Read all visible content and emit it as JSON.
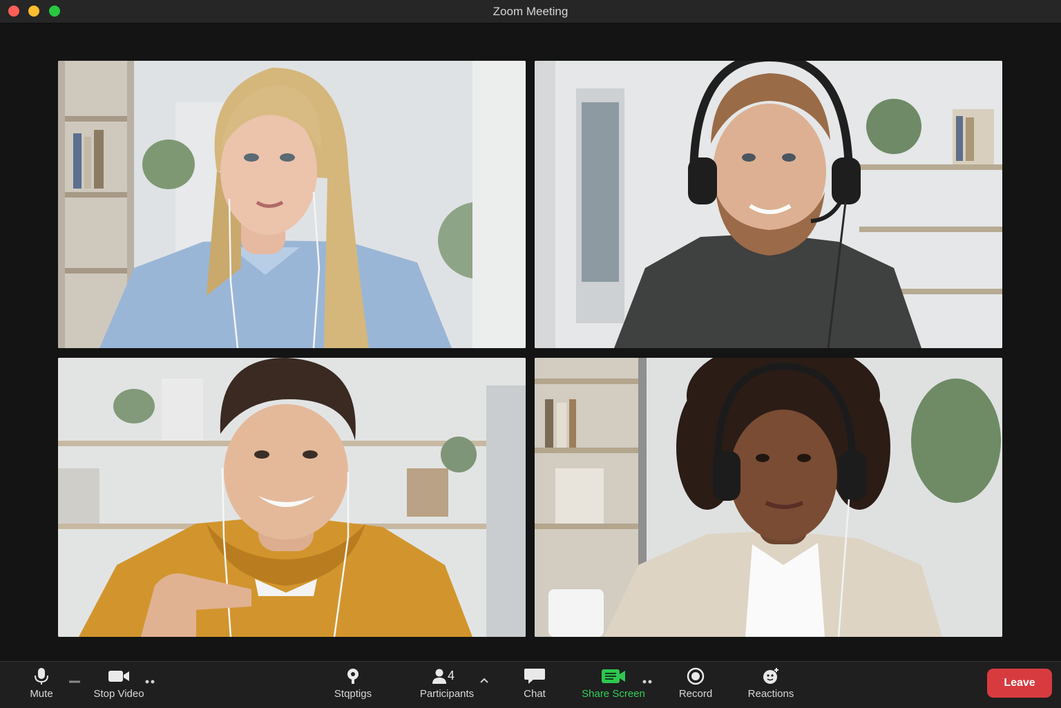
{
  "window": {
    "title": "Zoom Meeting"
  },
  "toolbar": {
    "mute": "Mute",
    "stop_video": "Stop Video",
    "settings": "Stqptigs",
    "participants": "Participants",
    "participant_count": "4",
    "chat": "Chat",
    "share_screen": "Share Screen",
    "record": "Record",
    "reactions": "Reactions",
    "leave": "Leave"
  },
  "colors": {
    "leave": "#d83b3f",
    "share_screen": "#35d05a",
    "window_bg": "#141414"
  },
  "icons": [
    "microphone-icon",
    "video-camera-icon",
    "settings-icon",
    "participants-icon",
    "chat-icon",
    "share-screen-icon",
    "record-icon",
    "reactions-icon"
  ]
}
